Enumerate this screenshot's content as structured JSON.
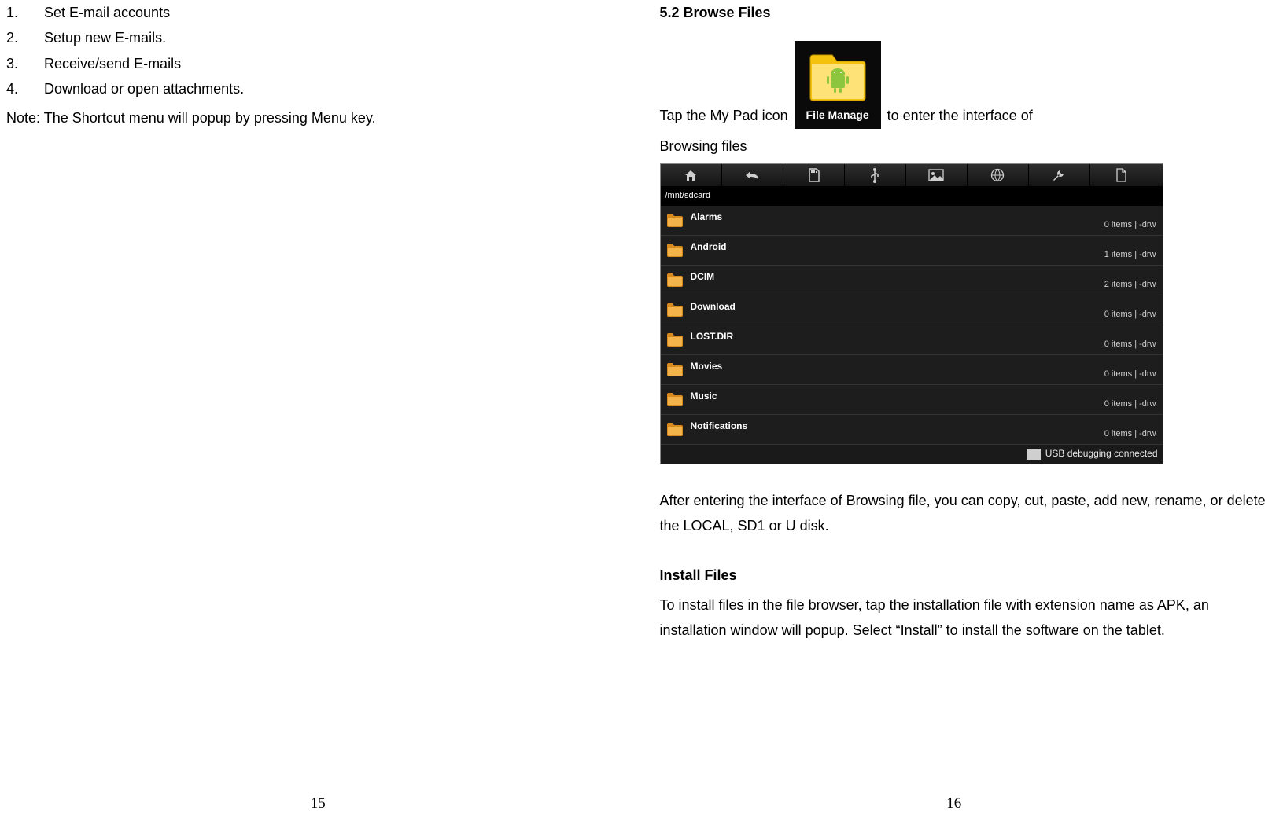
{
  "left": {
    "list": [
      {
        "n": "1.",
        "text": "Set E-mail accounts"
      },
      {
        "n": "2.",
        "text": "Setup new E-mails."
      },
      {
        "n": "3.",
        "text": "Receive/send E-mails"
      },
      {
        "n": "4.",
        "text": "Download or open attachments."
      }
    ],
    "note": "Note: The Shortcut menu will popup by pressing Menu key.",
    "page_number": "15"
  },
  "right": {
    "section_title": "5.2 Browse Files",
    "tap_line_pre": "Tap the My Pad icon",
    "icon_label": "File Manage",
    "tap_line_post": "to enter the interface of",
    "tap_line_cont": "Browsing files",
    "filemanager": {
      "path": "/mnt/sdcard",
      "rows": [
        {
          "name": "Alarms",
          "meta": "0 items | -drw"
        },
        {
          "name": "Android",
          "meta": "1 items | -drw"
        },
        {
          "name": "DCIM",
          "meta": "2 items | -drw"
        },
        {
          "name": "Download",
          "meta": "0 items | -drw"
        },
        {
          "name": "LOST.DIR",
          "meta": "0 items | -drw"
        },
        {
          "name": "Movies",
          "meta": "0 items | -drw"
        },
        {
          "name": "Music",
          "meta": "0 items | -drw"
        },
        {
          "name": "Notifications",
          "meta": "0 items | -drw"
        }
      ],
      "status": "USB debugging connected"
    },
    "after_para": "After entering the interface of Browsing file, you can copy, cut, paste, add new, rename, or delete the LOCAL, SD1 or U disk.",
    "install_heading": "Install Files",
    "install_body": "To install files in the file browser, tap the installation file with extension name as APK, an installation window will popup. Select “Install” to install the software on the tablet.",
    "page_number": "16"
  }
}
